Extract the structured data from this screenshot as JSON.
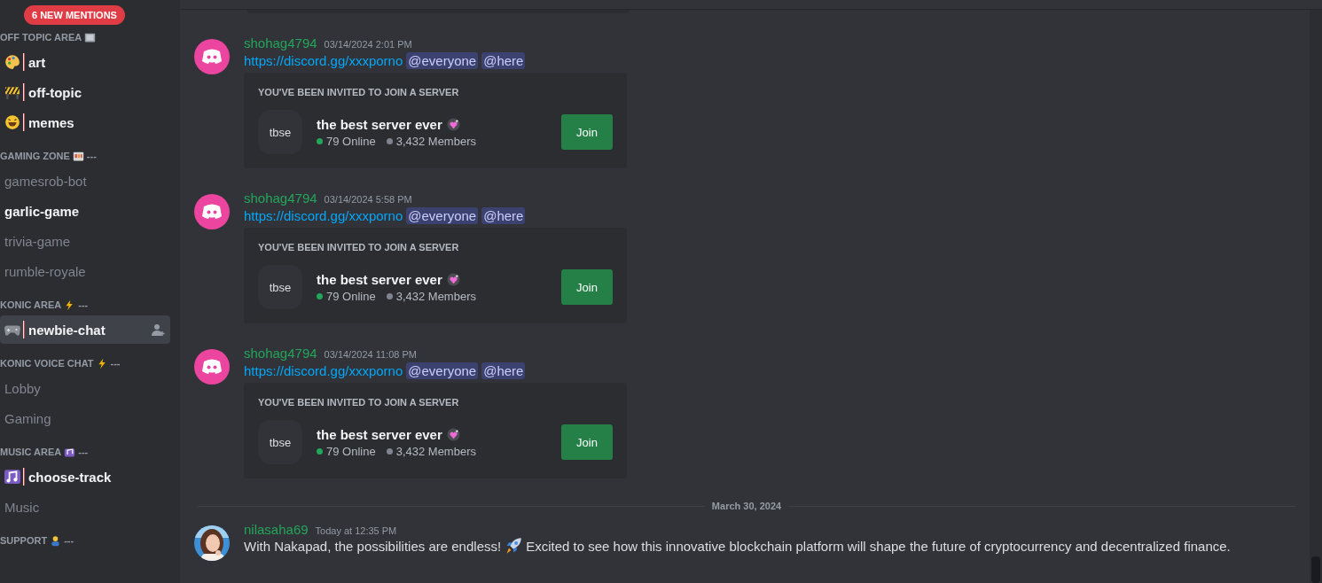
{
  "sidebar": {
    "mentions_badge": "6 NEW MENTIONS",
    "categories": [
      {
        "title": "OFF TOPIC AREA",
        "channels": [
          {
            "name": "art",
            "kind": "emoji",
            "unread": true,
            "selected": false
          },
          {
            "name": "off-topic",
            "kind": "emoji",
            "unread": true,
            "selected": false
          },
          {
            "name": "memes",
            "kind": "emoji",
            "unread": true,
            "selected": false
          }
        ]
      },
      {
        "title": "GAMING ZONE",
        "suffix": "---",
        "channels": [
          {
            "name": "gamesrob-bot",
            "unread": false,
            "selected": false
          },
          {
            "name": "garlic-game",
            "unread": true,
            "selected": false
          },
          {
            "name": "trivia-game",
            "unread": false,
            "selected": false
          },
          {
            "name": "rumble-royale",
            "unread": false,
            "selected": false
          }
        ]
      },
      {
        "title": "KONIC AREA",
        "suffix": "---",
        "channels": [
          {
            "name": "newbie-chat",
            "kind": "emoji",
            "unread": true,
            "selected": true
          }
        ]
      },
      {
        "title": "KONIC VOICE CHAT",
        "suffix": "---",
        "channels": [
          {
            "name": "Lobby",
            "unread": false,
            "selected": false
          },
          {
            "name": "Gaming",
            "unread": false,
            "selected": false
          }
        ]
      },
      {
        "title": "MUSIC AREA",
        "suffix": "---",
        "channels": [
          {
            "name": "choose-track",
            "kind": "emoji",
            "unread": true,
            "selected": false
          },
          {
            "name": "Music",
            "unread": false,
            "selected": false
          }
        ]
      },
      {
        "title": "SUPPORT",
        "suffix": "---"
      }
    ]
  },
  "messages": [
    {
      "kind": "invite",
      "author": "shohag4794",
      "timestamp": "03/14/2024 2:01 PM",
      "link": "https://discord.gg/xxxporno",
      "mentions": [
        "@everyone",
        "@here"
      ],
      "invite": {
        "heading": "YOU'VE BEEN INVITED TO JOIN A SERVER",
        "icon_text": "tbse",
        "server_name": "the best server ever",
        "online": "79 Online",
        "members": "3,432 Members",
        "button": "Join"
      }
    },
    {
      "kind": "invite",
      "author": "shohag4794",
      "timestamp": "03/14/2024 5:58 PM",
      "link": "https://discord.gg/xxxporno",
      "mentions": [
        "@everyone",
        "@here"
      ],
      "invite": {
        "heading": "YOU'VE BEEN INVITED TO JOIN A SERVER",
        "icon_text": "tbse",
        "server_name": "the best server ever",
        "online": "79 Online",
        "members": "3,432 Members",
        "button": "Join"
      }
    },
    {
      "kind": "invite",
      "author": "shohag4794",
      "timestamp": "03/14/2024 11:08 PM",
      "link": "https://discord.gg/xxxporno",
      "mentions": [
        "@everyone",
        "@here"
      ],
      "invite": {
        "heading": "YOU'VE BEEN INVITED TO JOIN A SERVER",
        "icon_text": "tbse",
        "server_name": "the best server ever",
        "online": "79 Online",
        "members": "3,432 Members",
        "button": "Join"
      }
    },
    {
      "kind": "divider",
      "label": "March 30, 2024"
    },
    {
      "kind": "text",
      "author": "nilasaha69",
      "timestamp": "Today at 12:35 PM",
      "text_before": "With Nakapad, the possibilities are endless!",
      "text_after": "Excited to see how this innovative blockchain platform will shape the future of cryptocurrency and decentralized finance."
    }
  ]
}
